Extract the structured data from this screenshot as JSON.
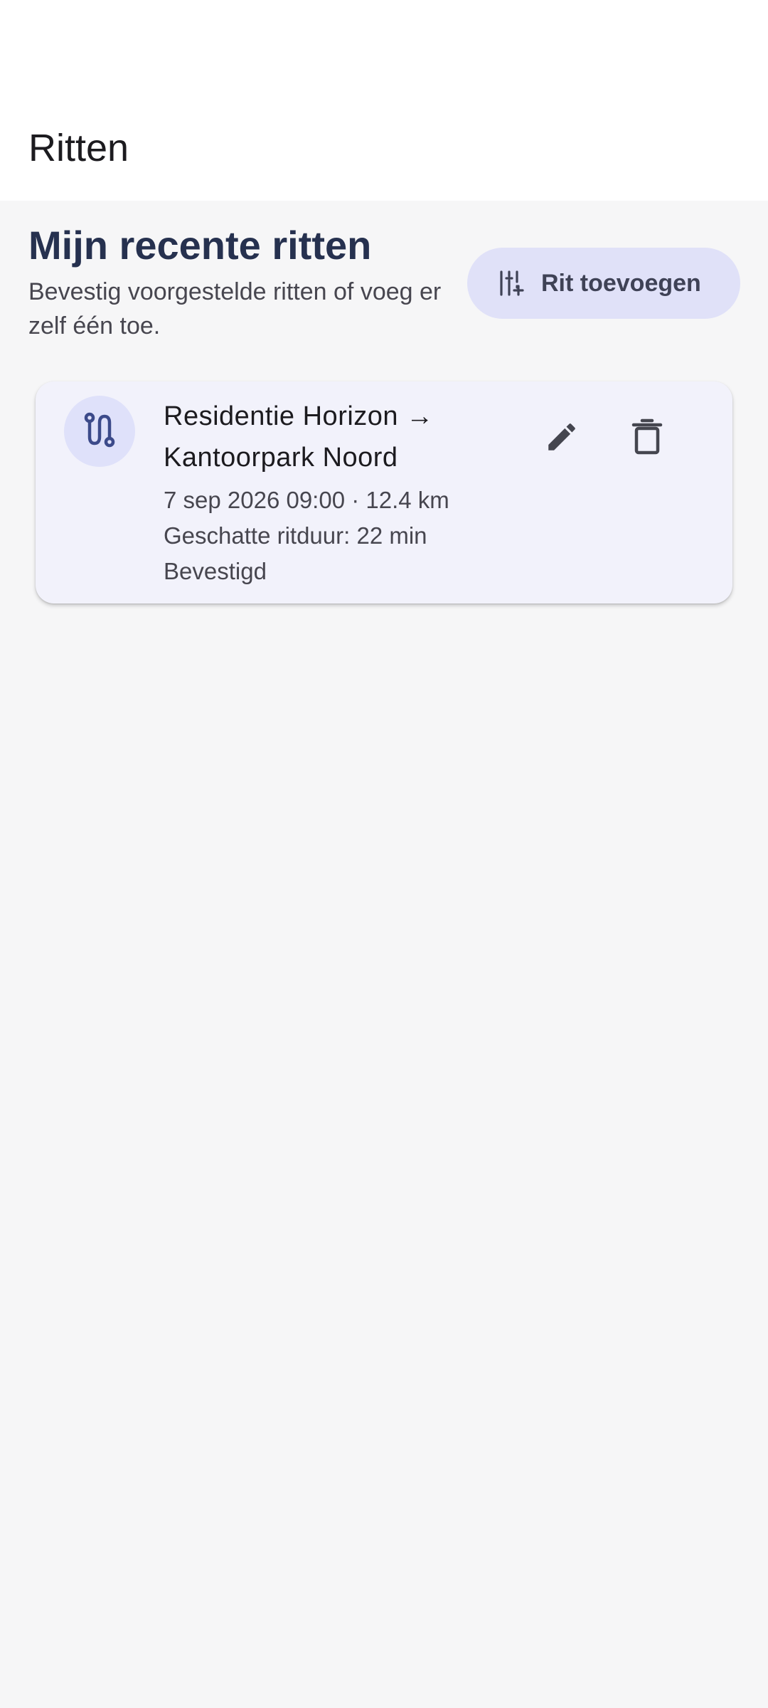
{
  "app_bar": {
    "title": "Ritten"
  },
  "section": {
    "title": "Mijn recente ritten",
    "subtitle": "Bevestig voorgestelde ritten of voeg er zelf één toe."
  },
  "add_button": {
    "icon": "tune-add-icon",
    "label": "Rit toevoegen"
  },
  "rides": [
    {
      "icon": "route-icon",
      "route": "Residentie Horizon → Kantoorpark Noord",
      "datetime_distance": "7 sep 2026 09:00 · 12.4 km",
      "duration": "Geschatte ritduur: 22 min",
      "status": "Bevestigd",
      "edit_icon": "edit-icon",
      "delete_icon": "delete-icon"
    }
  ],
  "colors": {
    "background": "#f6f6f7",
    "app_bar": "#ffffff",
    "title": "#26314f",
    "button_bg": "#e0e1f8",
    "card_bg": "#f2f2fb",
    "accent": "#3c4a8a"
  }
}
